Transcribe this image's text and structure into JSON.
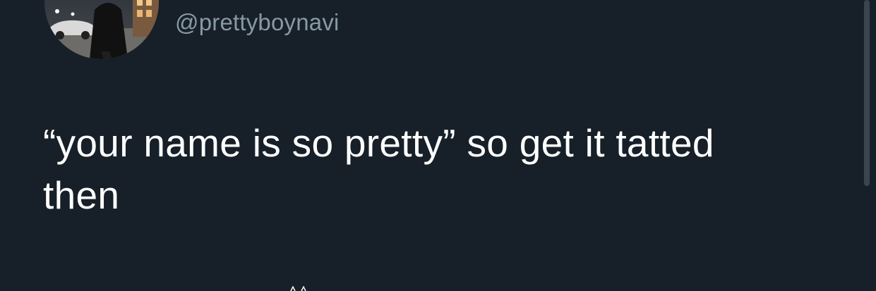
{
  "tweet": {
    "handle": "@prettyboynavi",
    "text": "“your name is so pretty” so get it tatted then"
  },
  "theme": {
    "background": "#172029",
    "handle_color": "#8899a6",
    "text_color": "#ffffff",
    "scrollbar_color": "#3b454f"
  },
  "icons": {
    "avatar": "profile-photo"
  }
}
